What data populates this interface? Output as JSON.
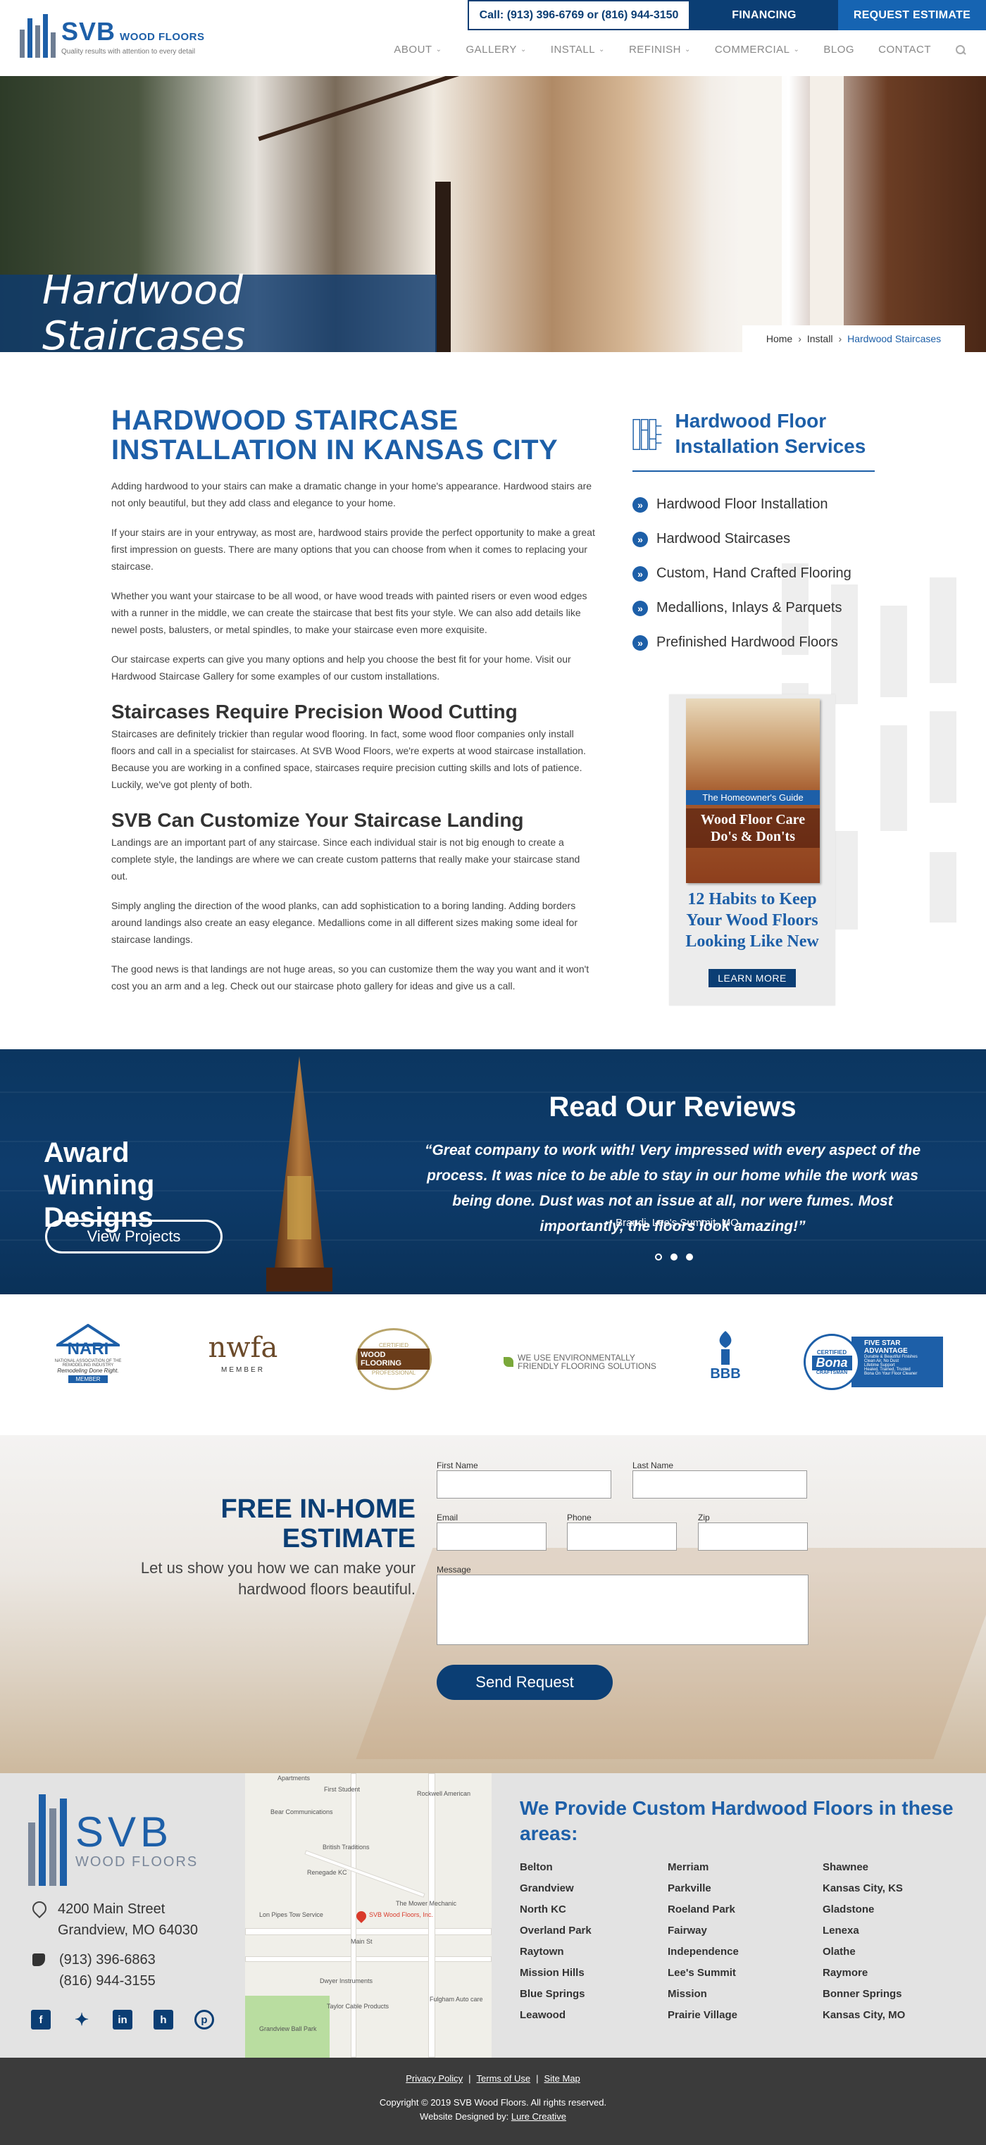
{
  "header": {
    "phone_line": "Call: (913) 396-6769 or (816) 944-3150",
    "financing": "FINANCING",
    "request_estimate": "REQUEST ESTIMATE",
    "logo_svb": "SVB",
    "logo_wood_floors": "WOOD FLOORS",
    "logo_tagline": "Quality results with attention to every detail",
    "nav": [
      "ABOUT",
      "GALLERY",
      "INSTALL",
      "REFINISH",
      "COMMERCIAL",
      "BLOG",
      "CONTACT"
    ]
  },
  "hero": {
    "title": "Hardwood Staircases",
    "breadcrumb": [
      "Home",
      "Install",
      "Hardwood Staircases"
    ]
  },
  "article": {
    "title": "HARDWOOD STAIRCASE INSTALLATION IN KANSAS CITY",
    "p1": "Adding hardwood to your stairs can make a dramatic change in your home's appearance. Hardwood stairs are not only beautiful, but they add class and elegance to your home.",
    "p2": "If your stairs are in your entryway, as most are, hardwood stairs provide the perfect opportunity to make a great first impression on guests. There are many options that you can choose from when it comes to replacing your staircase.",
    "p3": "Whether you want your staircase to be all wood, or have wood treads with painted risers or even wood edges with a runner in the middle, we can create the staircase that best fits your style. We can also add details like newel posts, balusters, or metal spindles, to make your staircase even more exquisite.",
    "p4": "Our staircase experts can give you many options and help you choose the best fit for your home. Visit our Hardwood Staircase Gallery for some examples of our custom installations.",
    "h2a": "Staircases Require Precision Wood Cutting",
    "p5": "Staircases are definitely trickier than regular wood flooring. In fact, some wood floor companies only install floors and call in a specialist for staircases. At SVB Wood Floors, we're experts at wood staircase installation. Because you are working in a confined space, staircases require precision cutting skills and lots of patience. Luckily, we've got plenty of both.",
    "h2b": "SVB Can Customize Your Staircase Landing",
    "p6": "Landings are an important part of any staircase. Since each individual stair is not big enough to create a complete style, the landings are where we can create custom patterns that really make your staircase stand out.",
    "p7": "Simply angling the direction of the wood planks, can add sophistication to a boring landing. Adding borders around landings also create an easy elegance. Medallions come in all different sizes making some ideal for staircase landings.",
    "p8": "The good news is that landings are not huge areas, so you can customize them the way you want and it won't cost you an arm and a leg. Check out our staircase photo gallery for ideas and give us a call."
  },
  "sidebar": {
    "title": "Hardwood Floor Installation Services",
    "items": [
      "Hardwood Floor Installation",
      "Hardwood Staircases",
      "Custom, Hand Crafted Flooring",
      "Medallions, Inlays & Parquets",
      "Prefinished Hardwood Floors"
    ],
    "book_guide": "The Homeowner's Guide",
    "book_title": "Wood Floor Care Do's & Don'ts",
    "promo_heading": "12 Habits to Keep Your Wood Floors Looking Like New",
    "learn_more": "LEARN MORE"
  },
  "band": {
    "award_title": "Award Winning Designs",
    "view_projects": "View Projects",
    "reviews_title": "Read Our Reviews",
    "review_text": "“Great company to work with! Very impressed with every aspect of the process. It was nice to be able to stay in our home while the work was being done. Dust was not an issue at all, nor were fumes. Most importantly, the floors look amazing!”",
    "review_author": "~ Brandi, Lee's Summit, MO"
  },
  "logos": {
    "nari": "NARI",
    "nari_sub": "NATIONAL ASSOCIATION OF THE REMODELING INDUSTRY",
    "nari_tag": "Remodeling Done Right.",
    "nari_member": "MEMBER",
    "nwfa": "nwfa",
    "nwfa_member": "MEMBER",
    "wood_flooring": "WOOD FLOORING",
    "wood_certified": "CERTIFIED",
    "wood_professional": "PROFESSIONAL",
    "eco": "WE USE ENVIRONMENTALLY FRIENDLY FLOORING SOLUTIONS",
    "bbb": "BBB",
    "bona_certified": "CERTIFIED",
    "bona": "Bona",
    "bona_craftsman": "CRAFTSMAN",
    "bona_advantage": "FIVE STAR ADVANTAGE",
    "bona_points": [
      "Durable & Beautiful Finishes",
      "Clean Air, No Dust",
      "Lifetime Support",
      "Healed, Trained, Trusted",
      "Bona On Your Floor Cleaner"
    ]
  },
  "estimate": {
    "title": "FREE IN-HOME ESTIMATE",
    "subtitle": "Let us show you how we can make your hardwood floors beautiful.",
    "first_name": "First Name",
    "last_name": "Last Name",
    "email": "Email",
    "phone": "Phone",
    "zip": "Zip",
    "message": "Message",
    "send": "Send Request"
  },
  "footer_info": {
    "logo_svb": "SVB",
    "logo_wood_floors": "WOOD FLOORS",
    "address1": "4200 Main Street",
    "address2": "Grandview, MO 64030",
    "phone1": "(913) 396-6863",
    "phone2": "(816) 944-3155",
    "areas_title": "We Provide Custom Hardwood Floors in these areas:",
    "areas": [
      "Belton",
      "Merriam",
      "Shawnee",
      "Grandview",
      "Parkville",
      "Kansas City, KS",
      "North KC",
      "Roeland Park",
      "Gladstone",
      "Overland Park",
      "Fairway",
      "Lenexa",
      "Raytown",
      "Independence",
      "Olathe",
      "Mission Hills",
      "Lee's Summit",
      "Raymore",
      "Blue Springs",
      "Mission",
      "Bonner Springs",
      "Leawood",
      "Prairie Village",
      "Kansas City, MO"
    ],
    "map_labels": [
      "Apartments",
      "First Student",
      "Rockwell American",
      "Bear Communications",
      "British Traditions",
      "Renegade KC",
      "The Mower Mechanic",
      "Lon Pipes Tow Service",
      "SVB Wood Floors, Inc.",
      "Main St",
      "Dwyer Instruments",
      "Taylor Cable Products",
      "Fulgham Auto care",
      "Grandview Ball Park"
    ]
  },
  "footer": {
    "links": [
      "Privacy Policy",
      "Terms of Use",
      "Site Map"
    ],
    "copyright": "Copyright © 2019 SVB Wood Floors. All rights reserved.",
    "designed_by_label": "Website Designed by:",
    "designer": "Lure Creative"
  },
  "colors": {
    "brand_blue": "#1d5fa8",
    "navy": "#0b3e74",
    "footer_dark": "#3b3b3b"
  }
}
